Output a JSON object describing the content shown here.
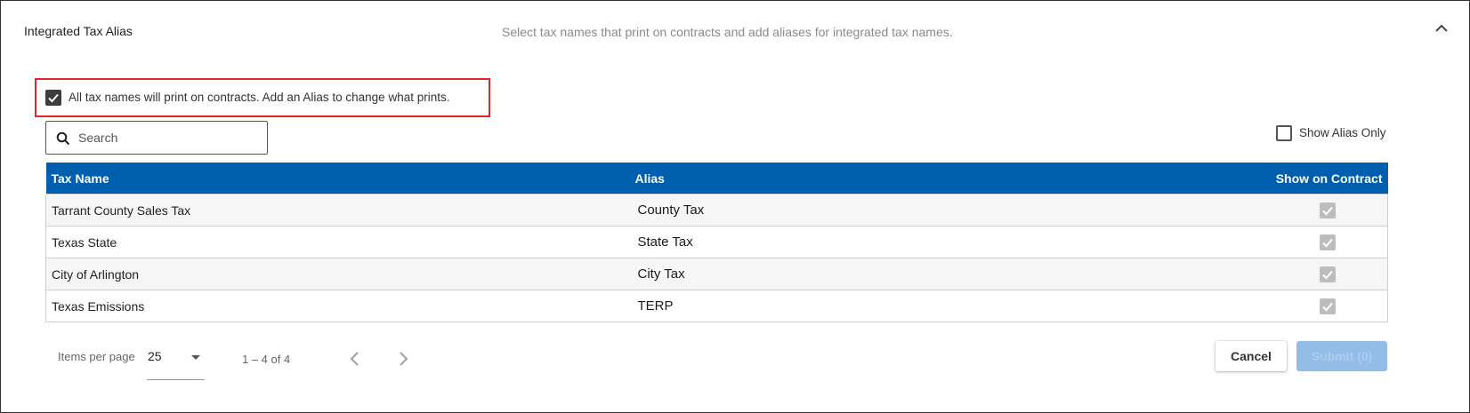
{
  "panel": {
    "title": "Integrated Tax Alias",
    "description": "Select tax names that print on contracts and add aliases for integrated tax names.",
    "collapse_icon": "chevron-up-icon"
  },
  "print_all": {
    "label": "All tax names will print on contracts. Add an Alias to change what prints.",
    "checked": true
  },
  "search": {
    "placeholder": "Search",
    "value": "",
    "icon": "search-icon"
  },
  "alias_only": {
    "label": "Show Alias Only",
    "checked": false
  },
  "table": {
    "columns": [
      "Tax Name",
      "Alias",
      "Show on Contract"
    ],
    "rows": [
      {
        "tax_name": "Tarrant County Sales Tax",
        "alias": "County Tax",
        "show_on_contract": true
      },
      {
        "tax_name": "Texas State",
        "alias": "State Tax",
        "show_on_contract": true
      },
      {
        "tax_name": "City of Arlington",
        "alias": "City Tax",
        "show_on_contract": true
      },
      {
        "tax_name": "Texas Emissions",
        "alias": "TERP",
        "show_on_contract": true
      }
    ]
  },
  "paginator": {
    "items_label": "Items per page",
    "page_size": "25",
    "range": "1 – 4 of 4",
    "prev_icon": "chevron-left-icon",
    "next_icon": "chevron-right-icon"
  },
  "actions": {
    "cancel_label": "Cancel",
    "submit_label": "Submit (0)"
  },
  "colors": {
    "header_bg": "#005eae",
    "highlight_border": "#e0262d",
    "submit_disabled": "#93bde6"
  }
}
